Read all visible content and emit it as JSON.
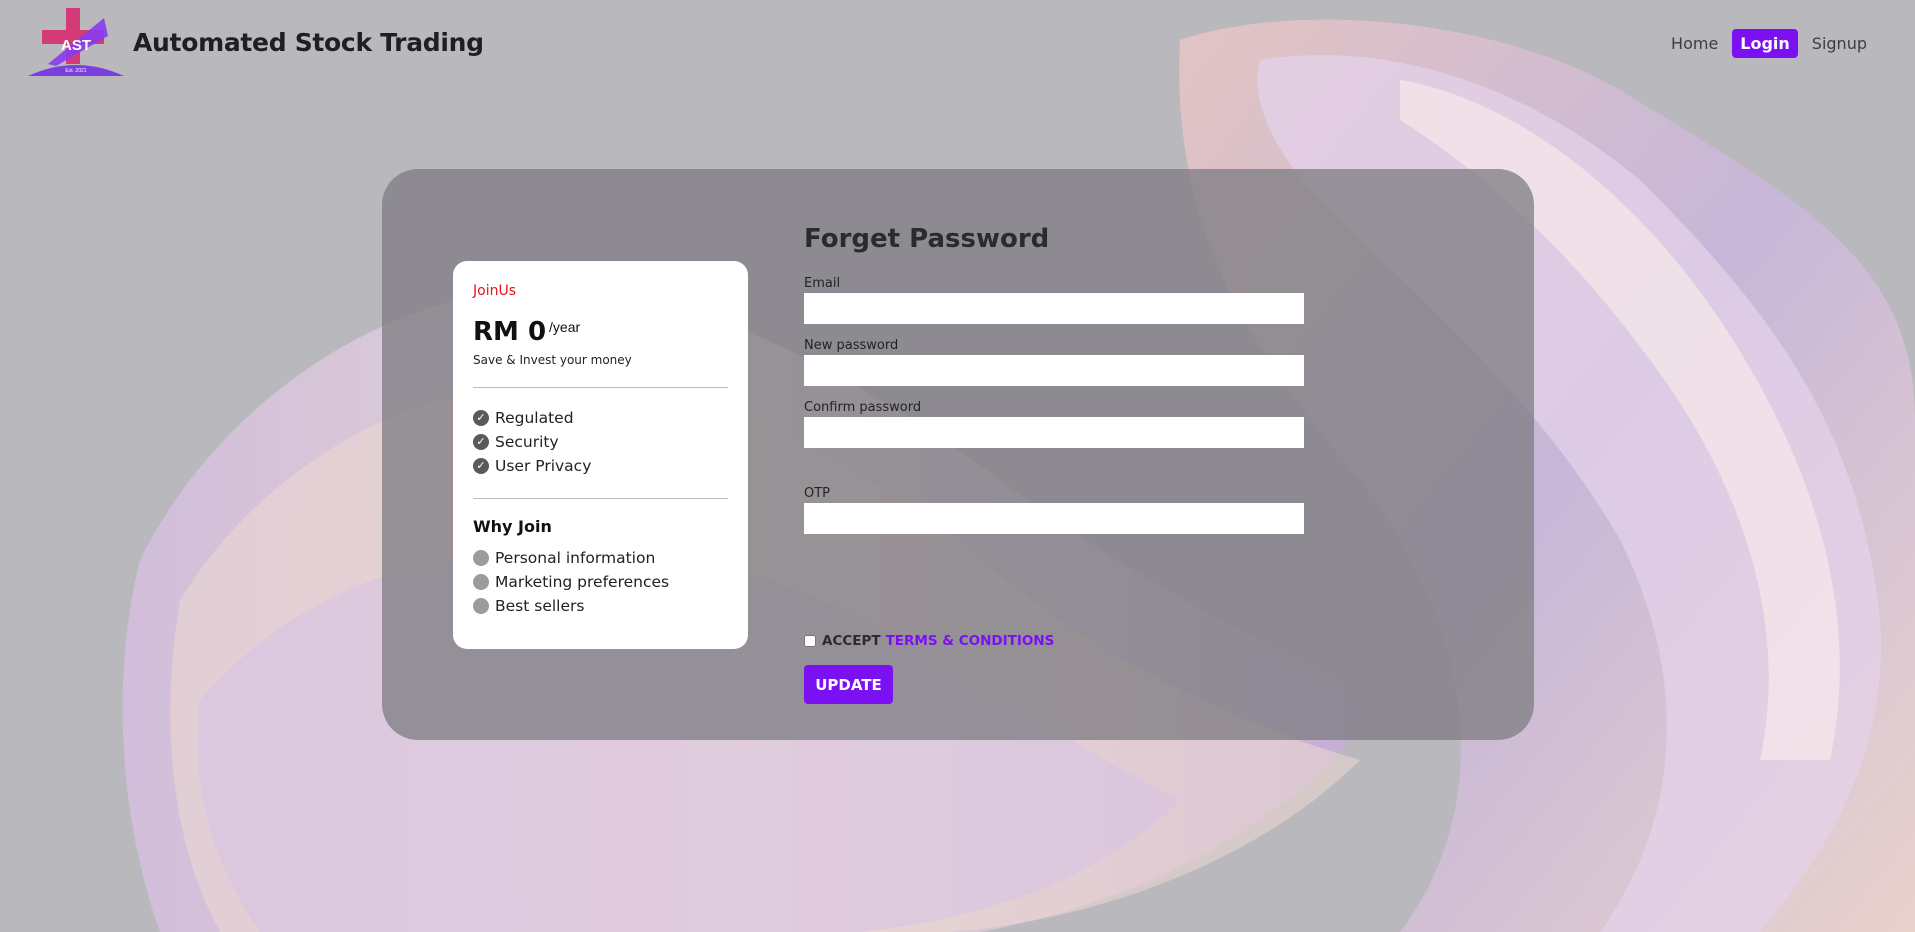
{
  "header": {
    "brand_title": "Automated Stock Trading",
    "logo_text": "AST",
    "logo_subtext": "Est. 2021",
    "nav": [
      {
        "label": "Home"
      },
      {
        "label": "Login"
      },
      {
        "label": "Signup"
      }
    ]
  },
  "card": {
    "join_label": "JoinUs",
    "price": "RM 0",
    "price_period": "/year",
    "tagline": "Save & Invest your money",
    "features": [
      "Regulated",
      "Security",
      "User Privacy"
    ],
    "why_title": "Why Join",
    "reasons": [
      "Personal information",
      "Marketing preferences",
      "Best sellers"
    ]
  },
  "form": {
    "title": "Forget Password",
    "email_label": "Email",
    "new_password_label": "New password",
    "confirm_password_label": "Confirm password",
    "otp_label": "OTP",
    "email_value": "",
    "new_password_value": "",
    "confirm_password_value": "",
    "otp_value": "",
    "accept_text": "ACCEPT",
    "terms_link": "TERMS & CONDITIONS",
    "submit_label": "UPDATE"
  },
  "colors": {
    "accent": "#7b10f2",
    "join_red": "#e0141e",
    "panel": "#807f84"
  }
}
